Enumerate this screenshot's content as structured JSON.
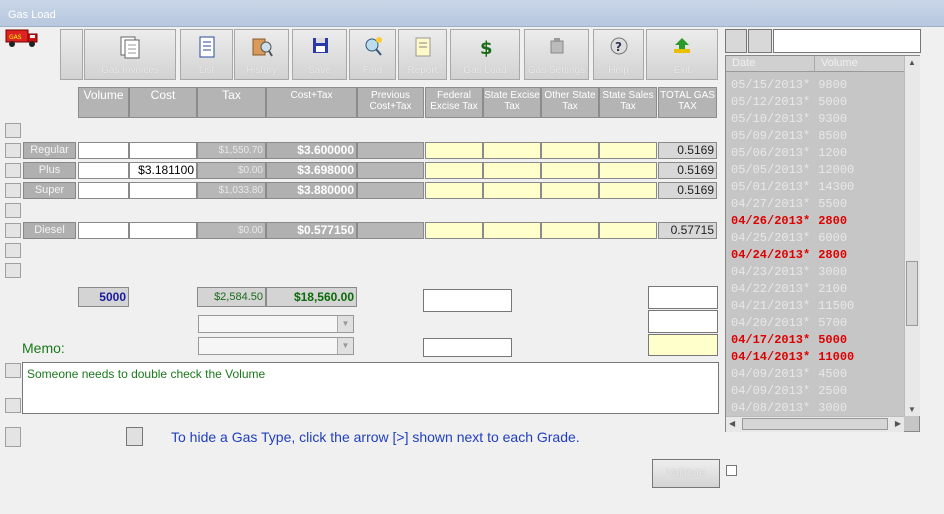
{
  "window": {
    "title": "Gas Load"
  },
  "toolbar": {
    "buttons": [
      {
        "label": "Gas Invoices",
        "icon": "documents-icon"
      },
      {
        "label": "List",
        "icon": "list-icon"
      },
      {
        "label": "History",
        "icon": "history-search-icon"
      },
      {
        "label": "Save",
        "icon": "floppy-icon"
      },
      {
        "label": "Find",
        "icon": "find-icon"
      },
      {
        "label": "Report",
        "icon": "report-icon"
      },
      {
        "label": "Gas Load",
        "icon": "dollar-icon"
      },
      {
        "label": "Gas Settings",
        "icon": "settings-icon"
      },
      {
        "label": "Help",
        "icon": "help-icon"
      },
      {
        "label": "Exit",
        "icon": "exit-icon"
      }
    ]
  },
  "headers": {
    "volume": "Volume",
    "cost": "Cost",
    "tax": "Tax",
    "cost_tax": "Cost+Tax",
    "prev_cost_tax": "Previous Cost+Tax",
    "federal": "Federal Excise Tax",
    "state_excise": "State Excise Tax",
    "other_state": "Other State Tax",
    "state_sales": "State Sales Tax",
    "total_gas_tax": "TOTAL GAS TAX"
  },
  "grades": [
    {
      "name": "Regular",
      "volume": "",
      "cost": "",
      "tax": "$1,550.70",
      "cost_tax": "$3.600000",
      "total_tax": "0.5169"
    },
    {
      "name": "Plus",
      "volume": "",
      "cost": "$3.181100",
      "tax": "$0.00",
      "cost_tax": "$3.698000",
      "total_tax": "0.5169"
    },
    {
      "name": "Super",
      "volume": "",
      "cost": "",
      "tax": "$1,033.80",
      "cost_tax": "$3.880000",
      "total_tax": "0.5169"
    },
    {
      "name": "Diesel",
      "volume": "",
      "cost": "",
      "tax": "$0.00",
      "cost_tax": "$0.577150",
      "total_tax": "0.57715"
    }
  ],
  "totals": {
    "volume": "5000",
    "tax": "$2,584.50",
    "cost_tax": "$18,560.00"
  },
  "memo": {
    "label": "Memo:",
    "text": "Someone needs to double check the Volume"
  },
  "hint": "To hide a Gas Type, click the arrow [>] shown next to each Grade.",
  "validate_button": "Validate",
  "history_list": {
    "columns": [
      "Date",
      "Volume"
    ],
    "rows": [
      {
        "date": "05/15/2013*",
        "volume": "9800",
        "highlight": false
      },
      {
        "date": "05/12/2013*",
        "volume": "5000",
        "highlight": false
      },
      {
        "date": "05/10/2013*",
        "volume": "9300",
        "highlight": false
      },
      {
        "date": "05/09/2013*",
        "volume": "8500",
        "highlight": false
      },
      {
        "date": "05/06/2013*",
        "volume": "1200",
        "highlight": false
      },
      {
        "date": "05/05/2013*",
        "volume": "12000",
        "highlight": false
      },
      {
        "date": "05/01/2013*",
        "volume": "14300",
        "highlight": false
      },
      {
        "date": "04/27/2013*",
        "volume": "5500",
        "highlight": false
      },
      {
        "date": "04/26/2013*",
        "volume": "2800",
        "highlight": true
      },
      {
        "date": "04/25/2013*",
        "volume": "6000",
        "highlight": false
      },
      {
        "date": "04/24/2013*",
        "volume": "2800",
        "highlight": true
      },
      {
        "date": "04/23/2013*",
        "volume": "3000",
        "highlight": false
      },
      {
        "date": "04/22/2013*",
        "volume": "2100",
        "highlight": false
      },
      {
        "date": "04/21/2013*",
        "volume": "11500",
        "highlight": false
      },
      {
        "date": "04/20/2013*",
        "volume": "5700",
        "highlight": false
      },
      {
        "date": "04/17/2013*",
        "volume": "5000",
        "highlight": true
      },
      {
        "date": "04/14/2013*",
        "volume": "11000",
        "highlight": true
      },
      {
        "date": "04/09/2013*",
        "volume": "4500",
        "highlight": false
      },
      {
        "date": "04/09/2013*",
        "volume": "2500",
        "highlight": false
      },
      {
        "date": "04/08/2013*",
        "volume": "3000",
        "highlight": false
      }
    ]
  },
  "colors": {
    "highlight": "#dd0000",
    "memo_text": "#1a7a1a",
    "hint_text": "#1f3fbf",
    "totals_volume": "#1a1aa0",
    "totals_cost_tax": "#0a6a0a"
  }
}
